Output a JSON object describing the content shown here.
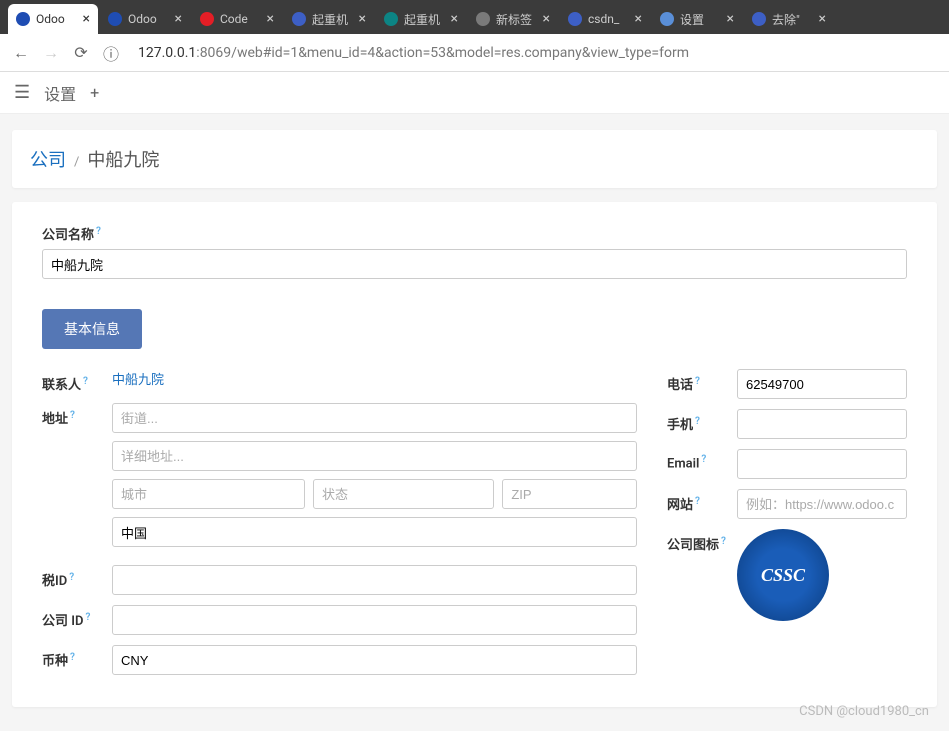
{
  "tabs": [
    {
      "title": "Odoo",
      "fav": "fav-blue"
    },
    {
      "title": "Odoo",
      "fav": "fav-blue"
    },
    {
      "title": "Code",
      "fav": "fav-opera"
    },
    {
      "title": "起重机",
      "fav": "fav-baidu"
    },
    {
      "title": "起重机",
      "fav": "fav-bing"
    },
    {
      "title": "新标签",
      "fav": "fav-gray"
    },
    {
      "title": "csdn_",
      "fav": "fav-baidu"
    },
    {
      "title": "设置",
      "fav": "fav-gear"
    },
    {
      "title": "去除\"",
      "fav": "fav-baidu"
    }
  ],
  "url": {
    "host": "127.0.0.1",
    "port": ":8069",
    "path": "/web#id=1&menu_id=4&action=53&model=res.company&view_type=form"
  },
  "app": {
    "title": "设置"
  },
  "breadcrumb": {
    "root": "公司",
    "sep": "/",
    "current": "中船九院"
  },
  "form": {
    "companyNameLabel": "公司名称",
    "companyName": "中船九院",
    "tabLabel": "基本信息",
    "contactLabel": "联系人",
    "contactValue": "中船九院",
    "addressLabel": "地址",
    "streetPh": "街道...",
    "street2Ph": "详细地址...",
    "cityPh": "城市",
    "statePh": "状态",
    "zipPh": "ZIP",
    "country": "中国",
    "taxIdLabel": "税ID",
    "companyIdLabel": "公司 ID",
    "currencyLabel": "币种",
    "currency": "CNY",
    "phoneLabel": "电话",
    "phone": "62549700",
    "mobileLabel": "手机",
    "emailLabel": "Email",
    "websiteLabel": "网站",
    "websitePh": "例如：https://www.odoo.c",
    "logoLabel": "公司图标",
    "logoText": "CSSC"
  },
  "watermark": "CSDN @cloud1980_cn"
}
